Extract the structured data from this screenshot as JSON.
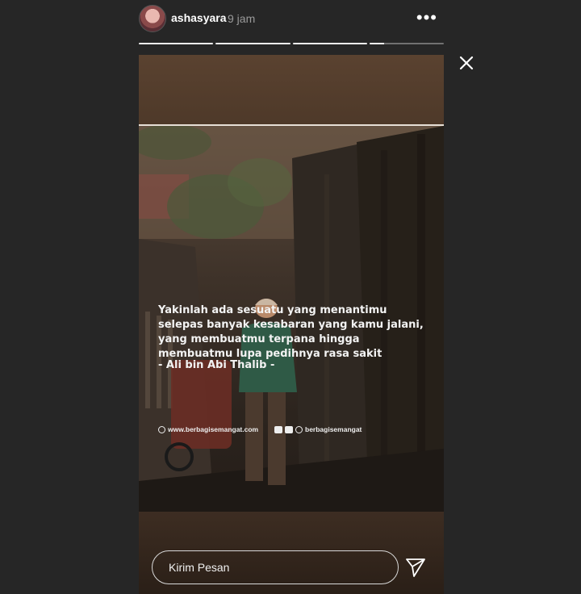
{
  "header": {
    "username": "ashasyara",
    "time": "9 jam",
    "more_label": "•••"
  },
  "progress": [
    1,
    1,
    1,
    0.2
  ],
  "story": {
    "quote": "Yakinlah ada sesuatu yang menantimu selepas banyak kesabaran yang kamu jalani, yang membuatmu terpana hingga membuatmu lupa pedihnya rasa sakit",
    "author": "- Ali bin Abi Thalib -",
    "website": "www.berbagisemangat.com",
    "social": "berbagisemangat"
  },
  "reply": {
    "placeholder": "Kirim Pesan"
  },
  "icons": {
    "close": "close-icon",
    "send": "paper-plane-icon",
    "more": "more-dots-icon"
  },
  "colors": {
    "background": "#262626",
    "text": "#ffffff",
    "muted": "#9a9a9a"
  }
}
